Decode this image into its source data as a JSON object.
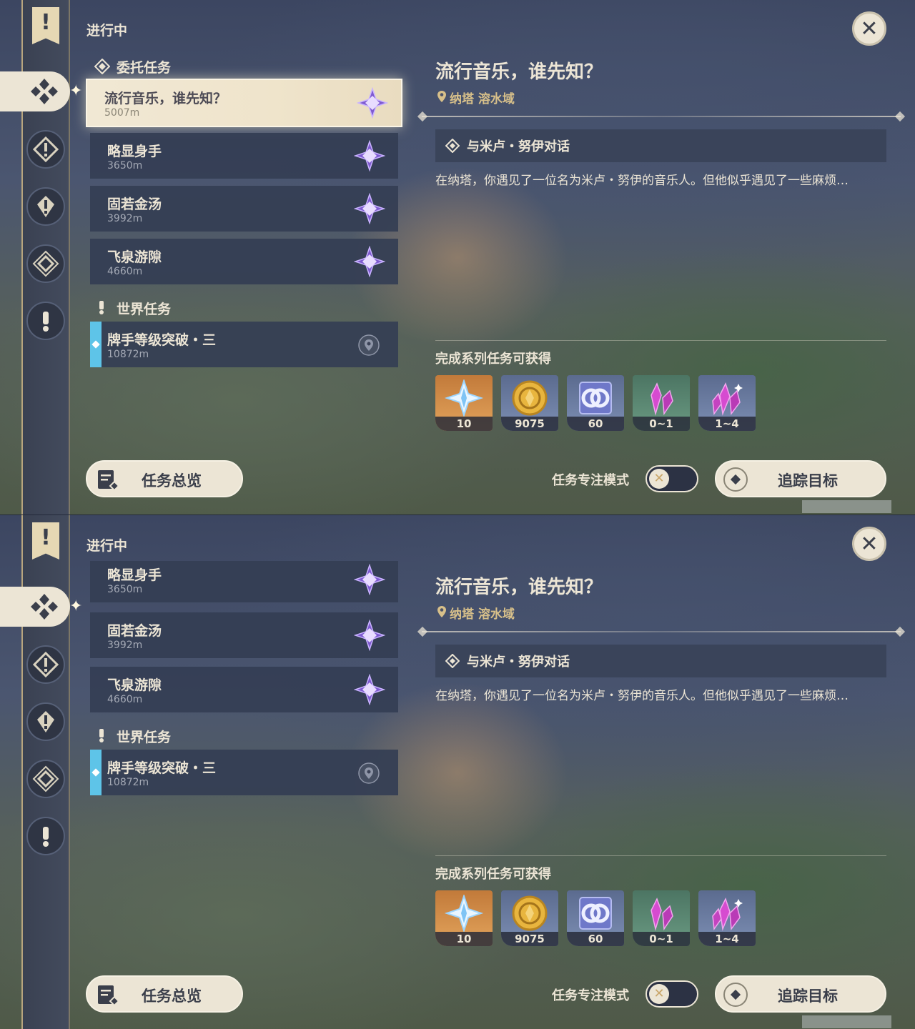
{
  "header": {
    "section": "进行中"
  },
  "categories": {
    "commission": "委托任务",
    "world": "世界任务"
  },
  "quests": [
    {
      "title": "流行音乐，谁先知？",
      "distance": "5007m"
    },
    {
      "title": "略显身手",
      "distance": "3650m"
    },
    {
      "title": "固若金汤",
      "distance": "3992m"
    },
    {
      "title": "飞泉游隙",
      "distance": "4660m"
    }
  ],
  "world_quests": [
    {
      "title": "牌手等级突破・三",
      "distance": "10872m"
    }
  ],
  "detail": {
    "title": "流行音乐，谁先知？",
    "location": "纳塔 溶水域",
    "objective": "与米卢・努伊对话",
    "description": "在纳塔，你遇见了一位名为米卢・努伊的音乐人。但他似乎遇见了一些麻烦…",
    "rewards_label": "完成系列任务可获得",
    "rewards": [
      {
        "icon": "primogem-icon",
        "count": "10"
      },
      {
        "icon": "mora-coin-icon",
        "count": "9075"
      },
      {
        "icon": "adventure-exp-icon",
        "count": "60"
      },
      {
        "icon": "crystal-chunk-icon",
        "count": "0~1"
      },
      {
        "icon": "crystal-cluster-icon",
        "count": "1~4"
      }
    ]
  },
  "buttons": {
    "overview": "任务总览",
    "focus_mode": "任务专注模式",
    "track": "追踪目标",
    "close": "✕",
    "toggle_knob": "✕"
  },
  "colors": {
    "accent_cream": "#ece5d5",
    "location_gold": "#d8c08a",
    "world_bar": "#5ec4e8",
    "star_purple": "#8a63d2"
  }
}
